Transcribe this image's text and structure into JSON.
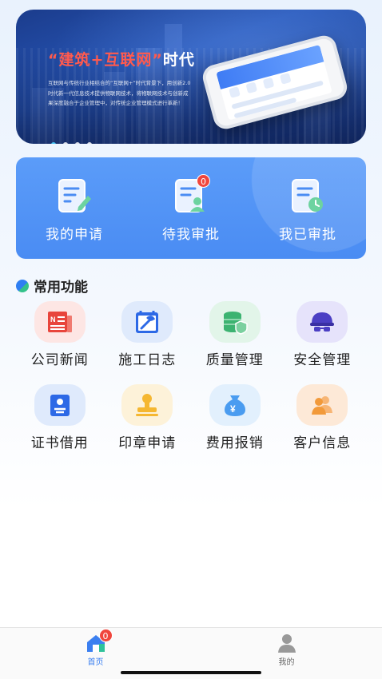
{
  "banner": {
    "title_quote_open": "“",
    "title_highlight": "建筑+互联网",
    "title_quote_close": "”",
    "title_suffix": "时代",
    "description": "互联网与传统行业相结合的“互联网+”时代背景下，用创新2.0时代新一代信息技术提供物联网技术，将物联网技术与创新成果深度融合于企业管理中，对传统企业管理模式进行革新！",
    "slides": 4,
    "active_slide": 0
  },
  "approval": {
    "items": [
      {
        "label": "我的申请",
        "icon": "edit-document-icon",
        "badge": null
      },
      {
        "label": "待我审批",
        "icon": "pending-approval-icon",
        "badge": "0"
      },
      {
        "label": "我已审批",
        "icon": "approved-document-icon",
        "badge": null
      }
    ]
  },
  "common_functions": {
    "title": "常用功能",
    "items": [
      {
        "label": "公司新闻",
        "icon": "newspaper-icon",
        "color": "#e8453c",
        "bg": "#fde6e4"
      },
      {
        "label": "施工日志",
        "icon": "construction-log-icon",
        "color": "#2d69e6",
        "bg": "#dfeafc"
      },
      {
        "label": "质量管理",
        "icon": "quality-shield-icon",
        "color": "#3cb371",
        "bg": "#e2f5e9"
      },
      {
        "label": "安全管理",
        "icon": "safety-helmet-icon",
        "color": "#4b3fc4",
        "bg": "#e6e3fb"
      },
      {
        "label": "证书借用",
        "icon": "certificate-icon",
        "color": "#2d69e6",
        "bg": "#dfeafc"
      },
      {
        "label": "印章申请",
        "icon": "seal-stamp-icon",
        "color": "#f5b731",
        "bg": "#fdf2d9"
      },
      {
        "label": "费用报销",
        "icon": "money-bag-icon",
        "color": "#4a9cf0",
        "bg": "#e2f0fd"
      },
      {
        "label": "客户信息",
        "icon": "customers-icon",
        "color": "#f29a3a",
        "bg": "#fde9d7"
      }
    ]
  },
  "tabbar": {
    "items": [
      {
        "label": "首页",
        "icon": "home-icon",
        "active": true,
        "badge": "0"
      },
      {
        "label": "我的",
        "icon": "profile-icon",
        "active": false,
        "badge": null
      }
    ]
  },
  "colors": {
    "accent": "#3b7ff0",
    "card": "#4a8cf3",
    "badge": "#f0463d"
  }
}
